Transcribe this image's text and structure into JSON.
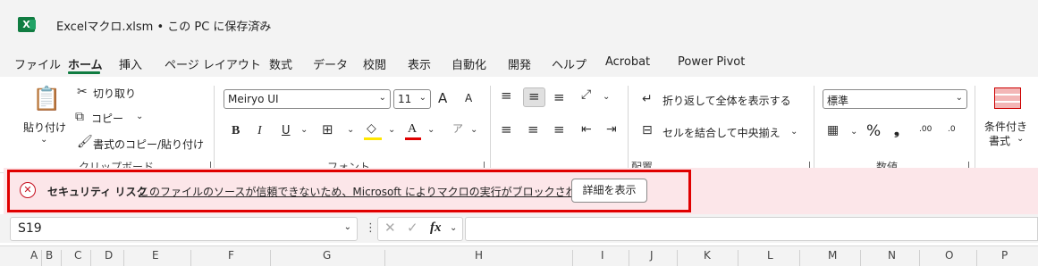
{
  "window": {
    "app_icon_letter": "X",
    "title": "Excelマクロ.xlsm • この PC に保存済み",
    "title_chevron": "⌵"
  },
  "tabs": [
    "ファイル",
    "ホーム",
    "挿入",
    "ページ レイアウト",
    "数式",
    "データ",
    "校閲",
    "表示",
    "自動化",
    "開発",
    "ヘルプ",
    "Acrobat",
    "Power Pivot"
  ],
  "active_tab": "ホーム",
  "ribbon": {
    "clipboard": {
      "paste_label": "貼り付け",
      "cut_label": "切り取り",
      "copy_label": "コピー",
      "format_painter_label": "書式のコピー/貼り付け",
      "group_label": "クリップボード"
    },
    "font": {
      "font_name": "Meiryo UI",
      "font_size": "11",
      "grow_label": "A",
      "shrink_label": "A",
      "bold": "B",
      "italic": "I",
      "underline": "U",
      "group_label": "フォント"
    },
    "alignment": {
      "wrap_text_label": "折り返して全体を表示する",
      "merge_center_label": "セルを結合して中央揃え",
      "group_label": "配置"
    },
    "number": {
      "format_value": "標準",
      "percent": "%",
      "comma": "❟",
      "inc_decimal": ".00",
      "dec_decimal": ".0",
      "group_label": "数値"
    },
    "styles": {
      "conditional_label_1": "条件付き",
      "conditional_label_2": "書式"
    }
  },
  "security_bar": {
    "title": "セキュリティ リスク",
    "message": "このファイルのソースが信頼できないため、Microsoft によりマクロの実行がブロックされました。",
    "button_label": "詳細を表示",
    "accent_color": "#c50f1f",
    "frame_color": "#e00000"
  },
  "formula_bar": {
    "name_box_value": "S19",
    "fx_label": "fx"
  },
  "columns": [
    "A",
    "B",
    "C",
    "D",
    "E",
    "F",
    "G",
    "H",
    "I",
    "J",
    "K",
    "L",
    "M",
    "N",
    "O",
    "P"
  ]
}
